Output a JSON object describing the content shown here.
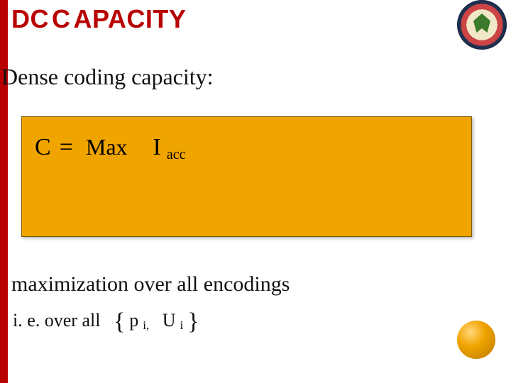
{
  "colors": {
    "accent_red": "#b80000",
    "formula_bg": "#f0a400",
    "text": "#111111"
  },
  "header": {
    "title_prefix": "DC ",
    "title_word_first": "C",
    "title_word_rest": "APACITY"
  },
  "logo": {
    "name": "institute-seal"
  },
  "subtitle": "Dense coding capacity:",
  "formula": {
    "lhs": "C",
    "equals": "=",
    "operator": "Max",
    "symbol": "I",
    "subscript": "acc"
  },
  "note1": "maximization over all encodings",
  "note2": {
    "prefix": "i. e. over all",
    "brace_open": "{",
    "item1": "p",
    "item1_sub": "i,",
    "item2": "U",
    "item2_sub": "i",
    "brace_close": "}"
  }
}
